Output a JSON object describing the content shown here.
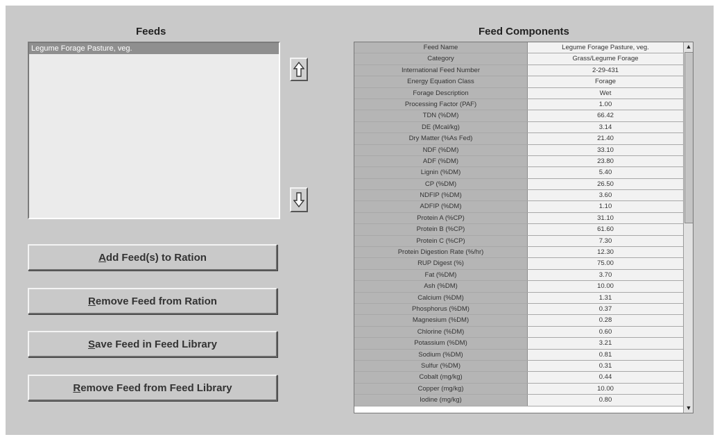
{
  "feeds_title": "Feeds",
  "components_title": "Feed Components",
  "feeds_list": [
    "Legume Forage Pasture, veg."
  ],
  "buttons": {
    "add": "Add Feed(s) to Ration",
    "remove_ration": "Remove Feed from Ration",
    "save_library": "Save Feed in Feed Library",
    "remove_library": "Remove Feed from Feed Library"
  },
  "components": [
    {
      "name": "Feed Name",
      "value": "Legume Forage Pasture, veg."
    },
    {
      "name": "Category",
      "value": "Grass/Legume Forage"
    },
    {
      "name": "International Feed Number",
      "value": "2-29-431"
    },
    {
      "name": "Energy Equation Class",
      "value": "Forage"
    },
    {
      "name": "Forage Description",
      "value": "Wet"
    },
    {
      "name": "Processing Factor (PAF)",
      "value": "1.00"
    },
    {
      "name": "TDN (%DM)",
      "value": "66.42"
    },
    {
      "name": "DE (Mcal/kg)",
      "value": "3.14"
    },
    {
      "name": "Dry Matter (%As Fed)",
      "value": "21.40"
    },
    {
      "name": "NDF (%DM)",
      "value": "33.10"
    },
    {
      "name": "ADF (%DM)",
      "value": "23.80"
    },
    {
      "name": "Lignin (%DM)",
      "value": "5.40"
    },
    {
      "name": "CP (%DM)",
      "value": "26.50"
    },
    {
      "name": "NDFIP (%DM)",
      "value": "3.60"
    },
    {
      "name": "ADFIP (%DM)",
      "value": "1.10"
    },
    {
      "name": "Protein A (%CP)",
      "value": "31.10"
    },
    {
      "name": "Protein B (%CP)",
      "value": "61.60"
    },
    {
      "name": "Protein C (%CP)",
      "value": "7.30"
    },
    {
      "name": "Protein Digestion Rate (%/hr)",
      "value": "12.30"
    },
    {
      "name": "RUP Digest (%)",
      "value": "75.00"
    },
    {
      "name": "Fat (%DM)",
      "value": "3.70"
    },
    {
      "name": "Ash (%DM)",
      "value": "10.00"
    },
    {
      "name": "Calcium (%DM)",
      "value": "1.31"
    },
    {
      "name": "Phosphorus (%DM)",
      "value": "0.37"
    },
    {
      "name": "Magnesium (%DM)",
      "value": "0.28"
    },
    {
      "name": "Chlorine (%DM)",
      "value": "0.60"
    },
    {
      "name": "Potassium (%DM)",
      "value": "3.21"
    },
    {
      "name": "Sodium (%DM)",
      "value": "0.81"
    },
    {
      "name": "Sulfur (%DM)",
      "value": "0.31"
    },
    {
      "name": "Cobalt (mg/kg)",
      "value": "0.44"
    },
    {
      "name": "Copper (mg/kg)",
      "value": "10.00"
    },
    {
      "name": "Iodine (mg/kg)",
      "value": "0.80"
    }
  ],
  "icons": {
    "move_up": "up-arrow-icon",
    "move_down": "down-arrow-icon",
    "scroll_up": "scroll-up-icon",
    "scroll_down": "scroll-down-icon"
  }
}
